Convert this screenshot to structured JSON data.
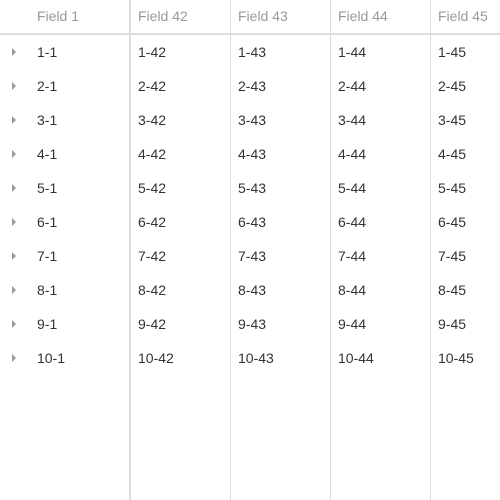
{
  "columns": [
    "Field 1",
    "Field 42",
    "Field 43",
    "Field 44",
    "Field 45"
  ],
  "rows": [
    [
      "1-1",
      "1-42",
      "1-43",
      "1-44",
      "1-45"
    ],
    [
      "2-1",
      "2-42",
      "2-43",
      "2-44",
      "2-45"
    ],
    [
      "3-1",
      "3-42",
      "3-43",
      "3-44",
      "3-45"
    ],
    [
      "4-1",
      "4-42",
      "4-43",
      "4-44",
      "4-45"
    ],
    [
      "5-1",
      "5-42",
      "5-43",
      "5-44",
      "5-45"
    ],
    [
      "6-1",
      "6-42",
      "6-43",
      "6-44",
      "6-45"
    ],
    [
      "7-1",
      "7-42",
      "7-43",
      "7-44",
      "7-45"
    ],
    [
      "8-1",
      "8-42",
      "8-43",
      "8-44",
      "8-45"
    ],
    [
      "9-1",
      "9-42",
      "9-43",
      "9-44",
      "9-45"
    ],
    [
      "10-1",
      "10-42",
      "10-43",
      "10-44",
      "10-45"
    ]
  ]
}
